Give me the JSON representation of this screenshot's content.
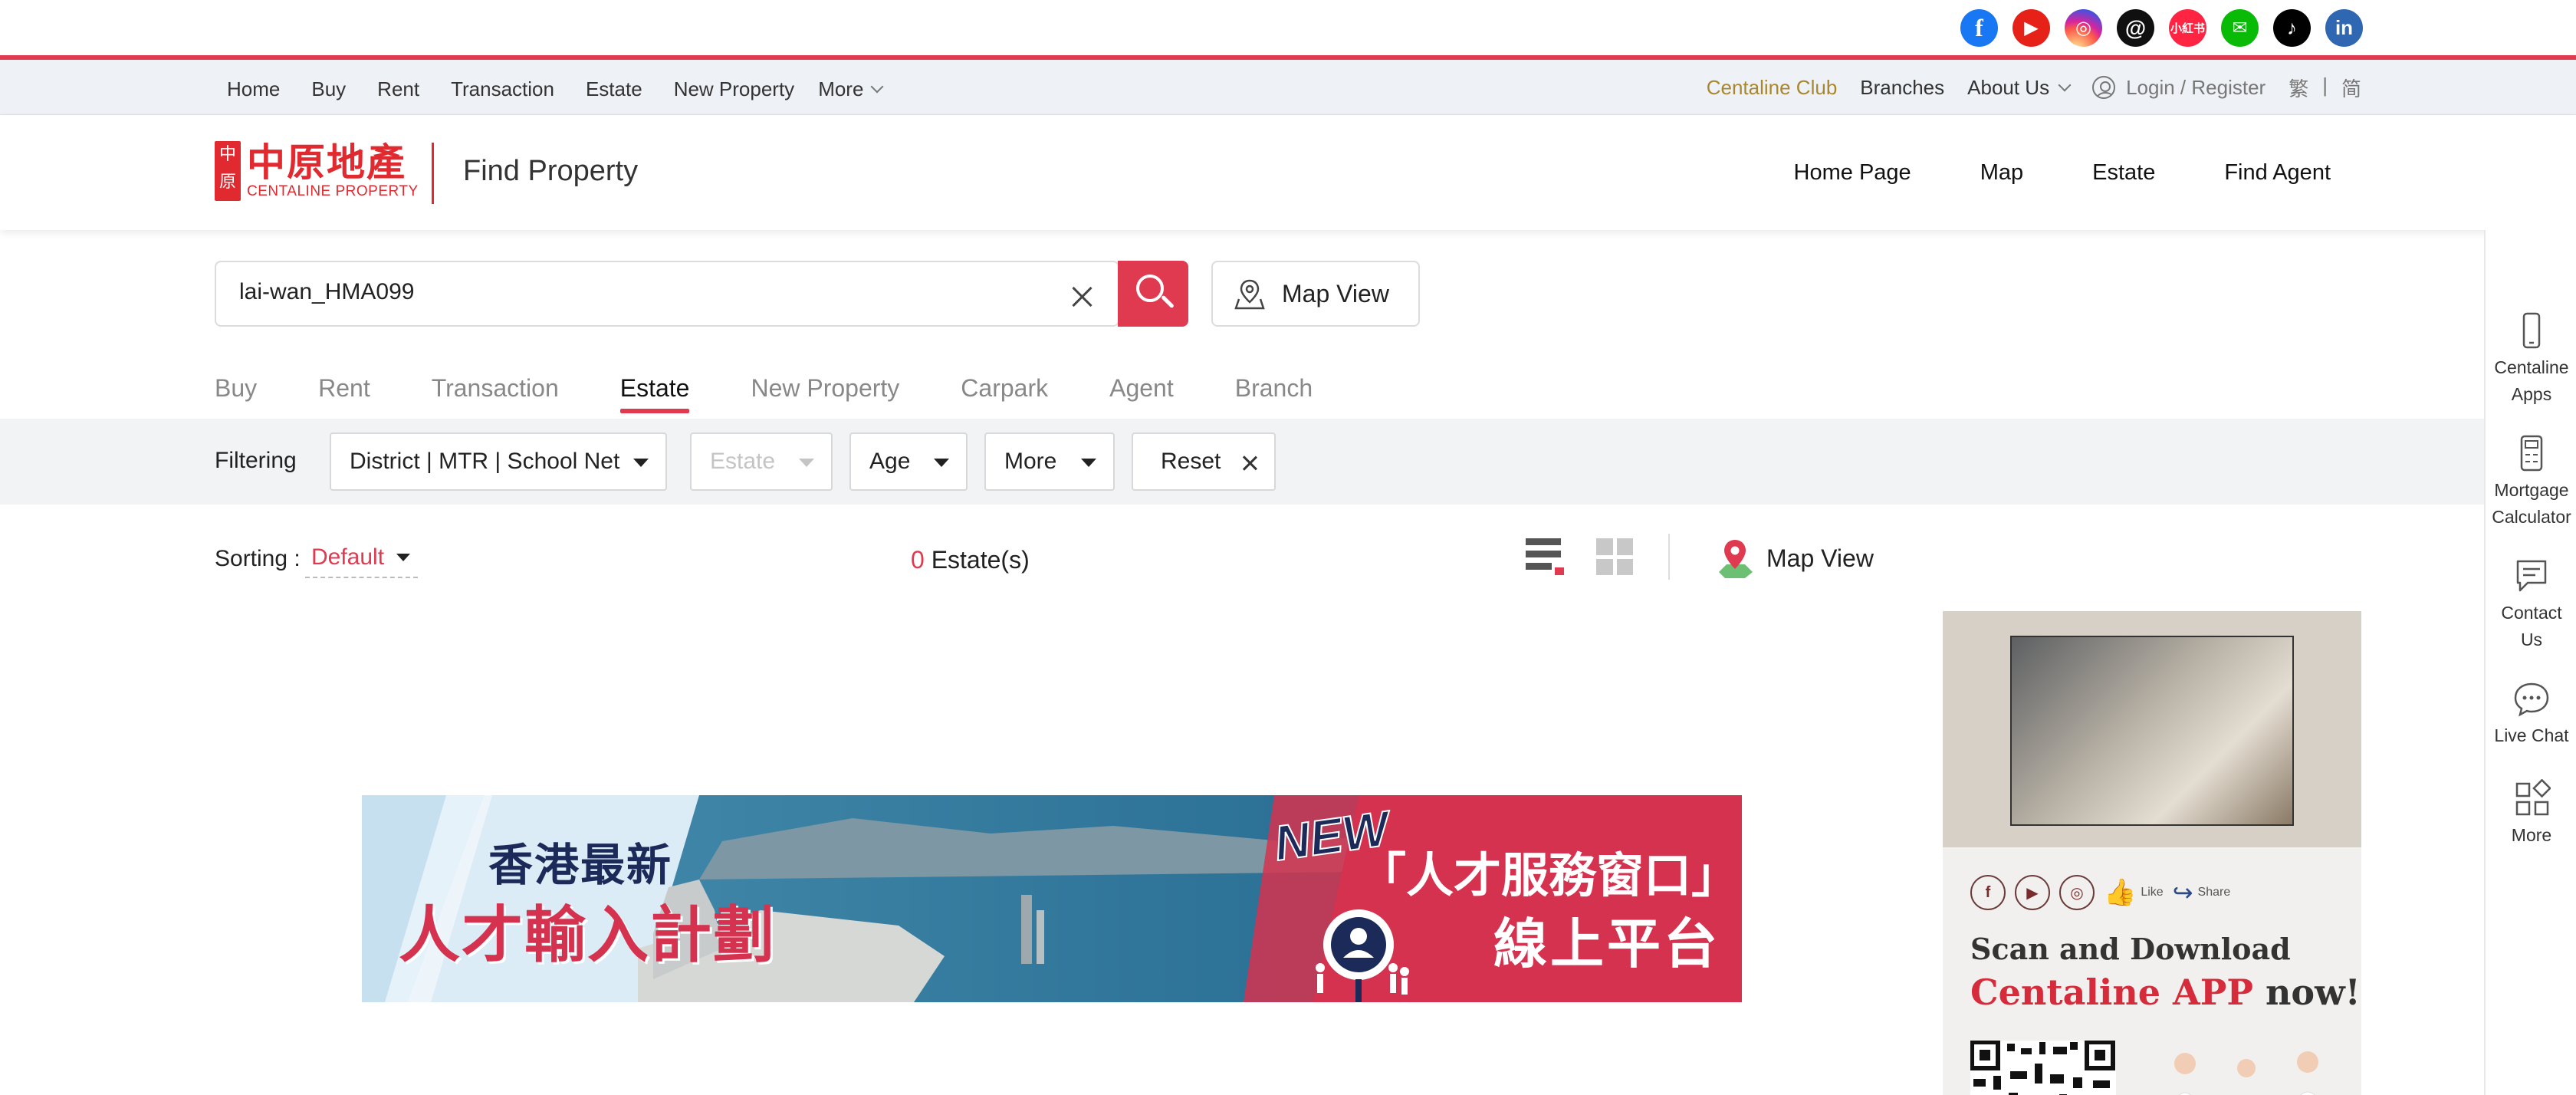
{
  "social": {
    "icons": [
      {
        "name": "facebook-icon",
        "glyph": "f",
        "color": "#1877f2"
      },
      {
        "name": "youtube-icon",
        "glyph": "▶",
        "color": "#e62117"
      },
      {
        "name": "instagram-icon",
        "glyph": "◎",
        "color": "#d6249f"
      },
      {
        "name": "threads-icon",
        "glyph": "@",
        "color": "#101010"
      },
      {
        "name": "xiaohongshu-icon",
        "glyph": "小紅书",
        "color": "#ff2442"
      },
      {
        "name": "wechat-icon",
        "glyph": "✉",
        "color": "#09bb07"
      },
      {
        "name": "tiktok-icon",
        "glyph": "♪",
        "color": "#010101"
      },
      {
        "name": "linkedin-icon",
        "glyph": "in",
        "color": "#2f67b2"
      }
    ]
  },
  "topnav": {
    "left": [
      "Home",
      "Buy",
      "Rent",
      "Transaction",
      "Estate",
      "New Property"
    ],
    "more": "More",
    "club": "Centaline Club",
    "branches": "Branches",
    "about": "About Us",
    "login": "Login / Register",
    "lang_trad": "繁",
    "lang_sep": "|",
    "lang_simp": "简"
  },
  "header": {
    "logo_mark": "中原",
    "logo_cn": "中原地產",
    "logo_en": "CENTALINE PROPERTY",
    "title": "Find Property",
    "nav": [
      "Home Page",
      "Map",
      "Estate",
      "Find Agent"
    ]
  },
  "search": {
    "value": "lai-wan_HMA099",
    "map_view": "Map View"
  },
  "tabs": [
    "Buy",
    "Rent",
    "Transaction",
    "Estate",
    "New Property",
    "Carpark",
    "Agent",
    "Branch"
  ],
  "tabs_active_index": 3,
  "filtering": {
    "label": "Filtering",
    "district": "District | MTR | School Net",
    "estate": "Estate",
    "age": "Age",
    "more": "More",
    "reset": "Reset"
  },
  "results": {
    "sorting_label": "Sorting :",
    "sorting_value": "Default",
    "count": "0",
    "count_label": "Estate(s)",
    "map_view": "Map View"
  },
  "banner": {
    "line1": "香港最新",
    "line2": "人才輸入計劃",
    "new_badge": "NEW",
    "right_line1": "「人才服務窗口」",
    "right_line2": "線上平台"
  },
  "ad": {
    "like": "Like",
    "share": "Share",
    "scan": "Scan and Download",
    "app": "Centaline APP",
    "now": "now!"
  },
  "side_rail": {
    "apps_1": "Centaline",
    "apps_2": "Apps",
    "mortgage_1": "Mortgage",
    "mortgage_2": "Calculator",
    "contact_1": "Contact",
    "contact_2": "Us",
    "chat": "Live Chat",
    "more": "More"
  },
  "colors": {
    "accent": "#e03a51",
    "brand_red": "#e02a2f",
    "club_gold": "#a9872e"
  }
}
